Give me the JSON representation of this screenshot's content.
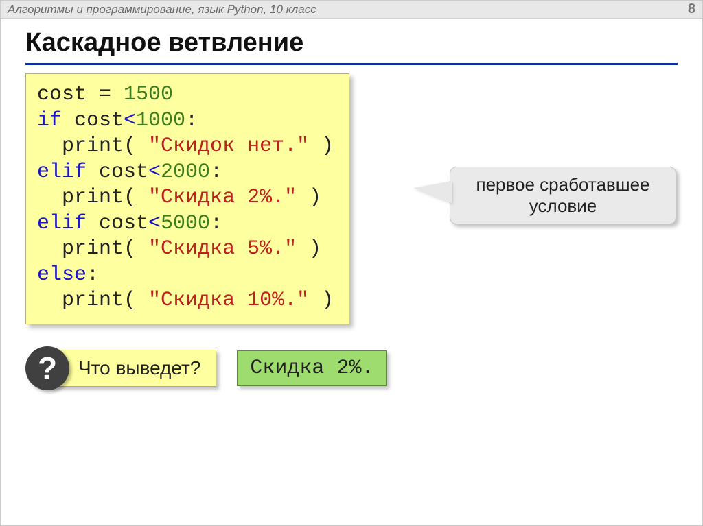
{
  "header": {
    "subject": "Алгоритмы и программирование, язык Python, 10 класс",
    "page_number": "8"
  },
  "title": "Каскадное ветвление",
  "code": {
    "l1a": "cost = ",
    "l1b": "1500",
    "l2a": "if",
    "l2b": " cost",
    "l2c": "<",
    "l2d": "1000",
    "l2e": ":",
    "l3a": "  print",
    "l3b": "( ",
    "l3c": "\"Скидок нет.\"",
    "l3d": " )",
    "l4a": "elif",
    "l4b": " cost",
    "l4c": "<",
    "l4d": "2000",
    "l4e": ":",
    "l5a": "  print",
    "l5b": "( ",
    "l5c": "\"Скидка 2%.\"",
    "l5d": " )",
    "l6a": "elif",
    "l6b": " cost",
    "l6c": "<",
    "l6d": "5000",
    "l6e": ":",
    "l7a": "  print",
    "l7b": "( ",
    "l7c": "\"Скидка 5%.\"",
    "l7d": " )",
    "l8a": "else",
    "l8b": ":",
    "l9a": "  print",
    "l9b": "( ",
    "l9c": "\"Скидка 10%.\"",
    "l9d": " )"
  },
  "callout": {
    "line1": "первое сработавшее",
    "line2": "условие"
  },
  "question": {
    "icon": "?",
    "text": "Что выведет?"
  },
  "answer": "Скидка 2%."
}
